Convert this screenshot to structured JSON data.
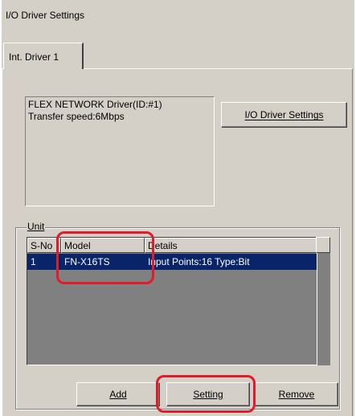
{
  "window": {
    "title": "I/O Driver Settings"
  },
  "tabs": [
    {
      "label": "Int. Driver 1",
      "active": true
    }
  ],
  "driver_info": {
    "line1": "FLEX NETWORK Driver(ID:#1)",
    "line2": "Transfer speed:6Mbps"
  },
  "io_settings_button": {
    "label": "I/O Driver Settings",
    "mnemonic": "I"
  },
  "unit_group": {
    "label": "Unit",
    "columns": [
      "S-No",
      "Model",
      "Details"
    ],
    "rows": [
      {
        "sno": "1",
        "model": "FN-X16TS",
        "details": "Input Points:16 Type:Bit",
        "selected": true
      }
    ]
  },
  "buttons": {
    "add": "Add",
    "setting": "Setting",
    "remove": "Remove"
  },
  "colors": {
    "panel": "#d4d0c8",
    "selection": "#0a246a",
    "highlight": "#e21a2a"
  }
}
